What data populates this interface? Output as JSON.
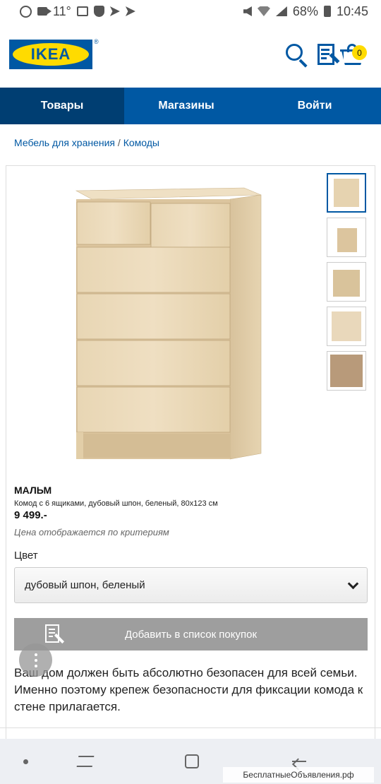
{
  "status_bar": {
    "temperature": "11°",
    "battery": "68%",
    "time": "10:45",
    "icons_left": [
      "whatsapp-icon",
      "video-icon",
      "image-icon",
      "shield-icon",
      "send-icon",
      "send-icon"
    ],
    "icons_right": [
      "mute-icon",
      "wifi-icon",
      "signal-icon",
      "battery-icon"
    ]
  },
  "header": {
    "logo_text": "IKEA",
    "logo_mark": "®",
    "cart_count": "0",
    "colors": {
      "brand_blue": "#0058a3",
      "brand_yellow": "#ffdb00"
    }
  },
  "nav": {
    "tabs": [
      {
        "label": "Товары",
        "active": true
      },
      {
        "label": "Магазины",
        "active": false
      },
      {
        "label": "Войти",
        "active": false
      }
    ]
  },
  "breadcrumb": {
    "items": [
      "Мебель для хранения",
      "Комоды"
    ],
    "separator": "/"
  },
  "product": {
    "name": "МАЛЬМ",
    "description": "Комод с 6 ящиками, дубовый шпон, беленый, 80x123 см",
    "price": "9 499.-",
    "price_note": "Цена отображается по критериям",
    "color_label": "Цвет",
    "color_selected": "дубовый шпон, беленый",
    "add_to_list_label": "Добавить в список покупок",
    "info_text": "Ваш дом должен быть абсолютно безопасен для всей семьи. Именно поэтому крепеж безопасности для фиксации комода к стене прилагается.",
    "thumbnail_count": 5,
    "active_thumbnail": 1
  },
  "watermark": "БесплатныеОбъявления.рф"
}
